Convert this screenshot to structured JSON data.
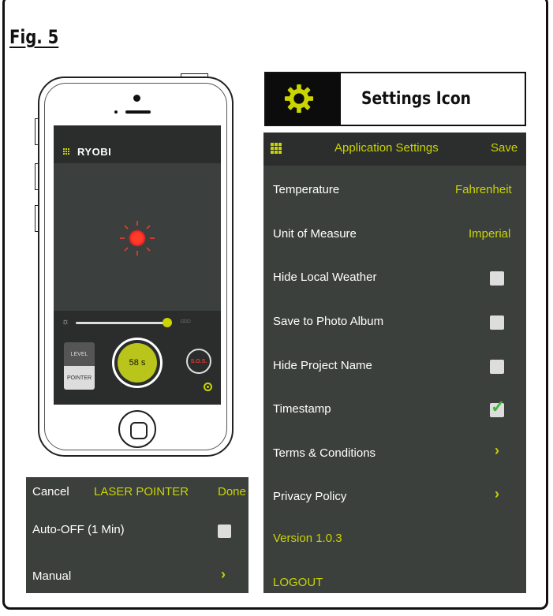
{
  "figure": {
    "title": "Fig. 5"
  },
  "phone": {
    "app_name": "RYOBI",
    "mode_level": "LEVEL",
    "mode_pointer": "POINTER",
    "timer": "58 s",
    "sos": "S.O.S.",
    "brightness_level": 0.95
  },
  "laser_pointer": {
    "cancel": "Cancel",
    "title": "LASER POINTER",
    "done": "Done",
    "auto_off_label": "Auto-OFF (1 Min)",
    "auto_off_checked": false,
    "manual_label": "Manual"
  },
  "callout": {
    "label": "Settings Icon",
    "icon": "gear-icon"
  },
  "settings": {
    "title": "Application Settings",
    "save": "Save",
    "temperature_label": "Temperature",
    "temperature_value": "Fahrenheit",
    "unit_label": "Unit of Measure",
    "unit_value": "Imperial",
    "hide_weather_label": "Hide Local Weather",
    "save_photo_label": "Save to Photo Album",
    "hide_project_label": "Hide Project Name",
    "timestamp_label": "Timestamp",
    "timestamp_checked": true,
    "terms_label": "Terms & Conditions",
    "privacy_label": "Privacy Policy",
    "version": "Version 1.0.3",
    "logout": "LOGOUT"
  },
  "colors": {
    "accent": "#c9d400",
    "panel_bg": "#3c403d",
    "laser": "#ff3b2a"
  }
}
